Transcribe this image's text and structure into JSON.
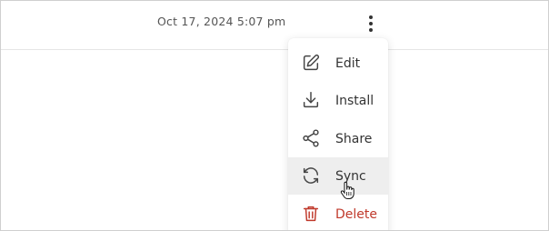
{
  "header": {
    "timestamp": "Oct 17, 2024 5:07 pm",
    "more_icon": "kebab-vertical-icon"
  },
  "menu": {
    "items": [
      {
        "label": "Edit",
        "icon": "edit-icon"
      },
      {
        "label": "Install",
        "icon": "download-icon"
      },
      {
        "label": "Share",
        "icon": "share-icon"
      },
      {
        "label": "Sync",
        "icon": "sync-icon",
        "state": "hover"
      },
      {
        "label": "Delete",
        "icon": "trash-icon",
        "color": "#c0392b"
      }
    ]
  },
  "colors": {
    "text": "#333333",
    "danger": "#c0392b",
    "hover_bg": "#eeeeee"
  }
}
